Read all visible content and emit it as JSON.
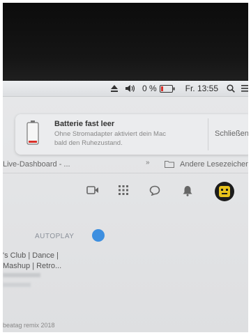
{
  "menubar": {
    "battery_percent": "0 %",
    "clock": "Fr. 13:55",
    "icons": [
      "eject-icon",
      "volume-icon",
      "battery-icon",
      "search-icon",
      "list-icon"
    ]
  },
  "notification": {
    "title": "Batterie fast leer",
    "body_line1": "Ohne Stromadapter aktiviert dein Mac",
    "body_line2": "bald den Ruhezustand.",
    "close_label": "Schließen"
  },
  "bookmarks": {
    "left_item": "Live-Dashboard - ...",
    "other_bookmarks": "Andere Lesezeichen"
  },
  "toolbar": {
    "icons": [
      "video-icon",
      "apps-icon",
      "chat-icon",
      "bell-icon",
      "avatar"
    ]
  },
  "player": {
    "autoplay_label": "AUTOPLAY",
    "video_title_line1": "'s Club | Dance |",
    "video_title_line2": "Mashup | Retro...",
    "footer": "beatag remix 2018"
  },
  "colors": {
    "battery_red": "#d9302a",
    "autoplay_toggle": "#3d8fe0",
    "avatar_yellow": "#e8c21c"
  }
}
